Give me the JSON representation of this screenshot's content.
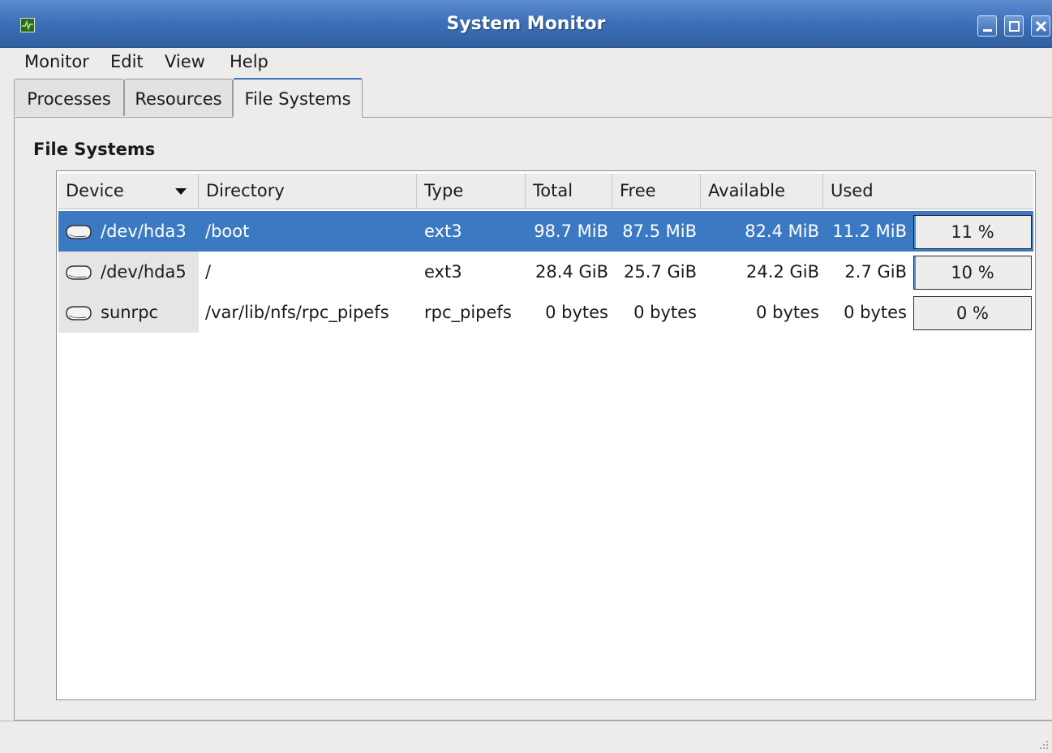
{
  "window": {
    "title": "System Monitor",
    "app_icon": "system-monitor-icon"
  },
  "menubar": {
    "items": [
      {
        "label": "Monitor"
      },
      {
        "label": "Edit"
      },
      {
        "label": "View"
      },
      {
        "label": "Help"
      }
    ]
  },
  "tabs": [
    {
      "label": "Processes"
    },
    {
      "label": "Resources"
    },
    {
      "label": "File Systems",
      "active": true
    }
  ],
  "section_title": "File Systems",
  "table": {
    "columns": [
      "Device",
      "Directory",
      "Type",
      "Total",
      "Free",
      "Available",
      "Used"
    ],
    "sort_column": "Device",
    "rows": [
      {
        "device": "/dev/hda3",
        "directory": "/boot",
        "type": "ext3",
        "total": "98.7 MiB",
        "free": "87.5 MiB",
        "available": "82.4 MiB",
        "used": "11.2 MiB",
        "usage_text": "11 %",
        "usage_fraction": 0.11,
        "selected": true
      },
      {
        "device": "/dev/hda5",
        "directory": "/",
        "type": "ext3",
        "total": "28.4 GiB",
        "free": "25.7 GiB",
        "available": "24.2 GiB",
        "used": "2.7 GiB",
        "usage_text": "10 %",
        "usage_fraction": 0.1,
        "selected": false
      },
      {
        "device": "sunrpc",
        "directory": "/var/lib/nfs/rpc_pipefs",
        "type": "rpc_pipefs",
        "total": "0 bytes",
        "free": "0 bytes",
        "available": "0 bytes",
        "used": "0 bytes",
        "usage_text": "0 %",
        "usage_fraction": 0.0,
        "selected": false
      }
    ]
  },
  "colors": {
    "titlebar": "#3e71ba",
    "selection": "#3c79c3",
    "usage_fill": "#4a8ad4"
  }
}
